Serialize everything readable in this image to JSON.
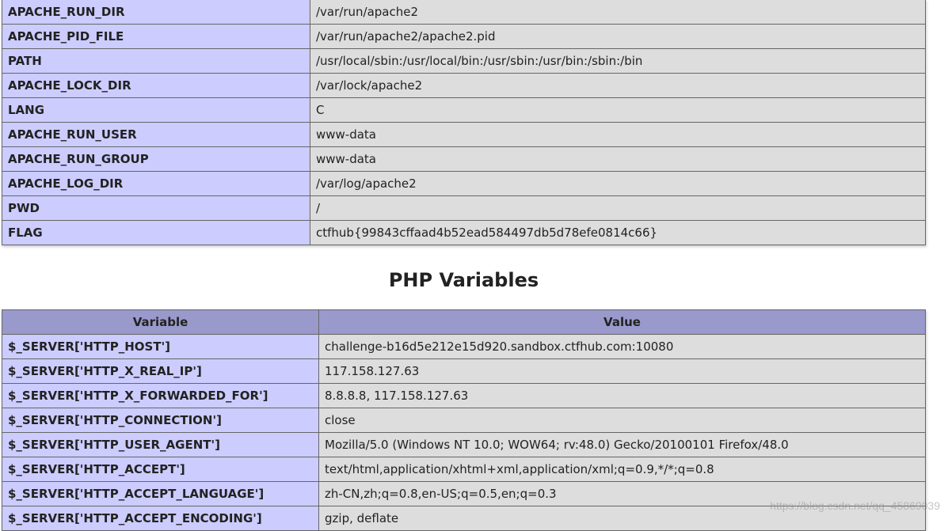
{
  "environment": {
    "rows": [
      {
        "key": "APACHE_RUN_DIR",
        "value": "/var/run/apache2"
      },
      {
        "key": "APACHE_PID_FILE",
        "value": "/var/run/apache2/apache2.pid"
      },
      {
        "key": "PATH",
        "value": "/usr/local/sbin:/usr/local/bin:/usr/sbin:/usr/bin:/sbin:/bin"
      },
      {
        "key": "APACHE_LOCK_DIR",
        "value": "/var/lock/apache2"
      },
      {
        "key": "LANG",
        "value": "C"
      },
      {
        "key": "APACHE_RUN_USER",
        "value": "www-data"
      },
      {
        "key": "APACHE_RUN_GROUP",
        "value": "www-data"
      },
      {
        "key": "APACHE_LOG_DIR",
        "value": "/var/log/apache2"
      },
      {
        "key": "PWD",
        "value": "/"
      },
      {
        "key": "FLAG",
        "value": "ctfhub{99843cffaad4b52ead584497db5d78efe0814c66}"
      }
    ]
  },
  "php_variables": {
    "title": "PHP Variables",
    "header": {
      "variable": "Variable",
      "value": "Value"
    },
    "rows": [
      {
        "key": "$_SERVER['HTTP_HOST']",
        "value": "challenge-b16d5e212e15d920.sandbox.ctfhub.com:10080"
      },
      {
        "key": "$_SERVER['HTTP_X_REAL_IP']",
        "value": "117.158.127.63"
      },
      {
        "key": "$_SERVER['HTTP_X_FORWARDED_FOR']",
        "value": "8.8.8.8, 117.158.127.63"
      },
      {
        "key": "$_SERVER['HTTP_CONNECTION']",
        "value": "close"
      },
      {
        "key": "$_SERVER['HTTP_USER_AGENT']",
        "value": "Mozilla/5.0 (Windows NT 10.0; WOW64; rv:48.0) Gecko/20100101 Firefox/48.0"
      },
      {
        "key": "$_SERVER['HTTP_ACCEPT']",
        "value": "text/html,application/xhtml+xml,application/xml;q=0.9,*/*;q=0.8"
      },
      {
        "key": "$_SERVER['HTTP_ACCEPT_LANGUAGE']",
        "value": "zh-CN,zh;q=0.8,en-US;q=0.5,en;q=0.3"
      },
      {
        "key": "$_SERVER['HTTP_ACCEPT_ENCODING']",
        "value": "gzip, deflate"
      }
    ]
  },
  "watermark": "https://blog.csdn.net/qq_45869039"
}
